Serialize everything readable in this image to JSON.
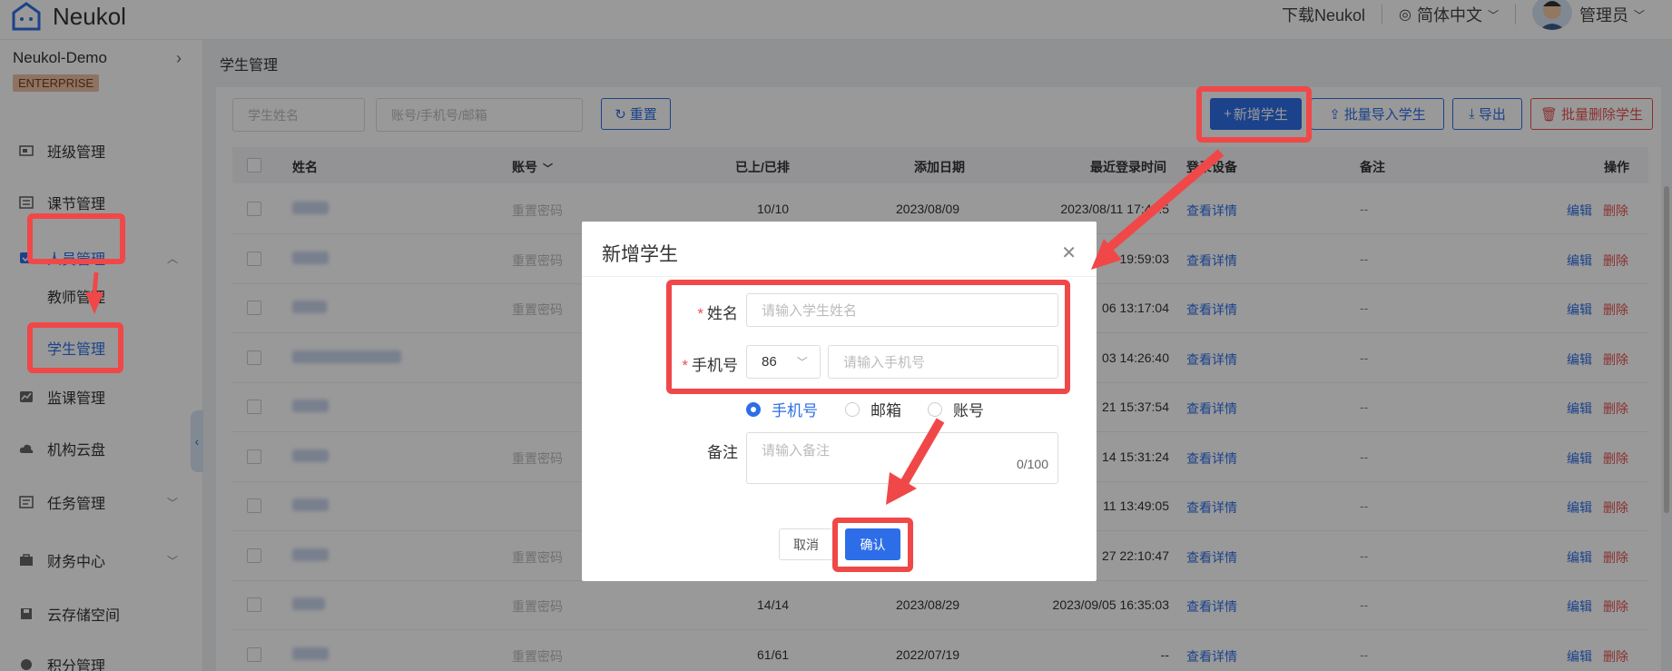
{
  "app": {
    "name": "Neukol"
  },
  "topbar": {
    "download": "下载Neukol",
    "language": "简体中文",
    "user": "管理员"
  },
  "sidebar": {
    "org": "Neukol-Demo",
    "badge": "ENTERPRISE",
    "items": [
      {
        "label": "班级管理",
        "icon": "class-icon"
      },
      {
        "label": "课节管理",
        "icon": "list-icon"
      },
      {
        "label": "人员管理",
        "icon": "people-icon"
      },
      {
        "label": "监课管理",
        "icon": "monitor-icon"
      },
      {
        "label": "机构云盘",
        "icon": "cloud-icon"
      },
      {
        "label": "任务管理",
        "icon": "task-icon"
      },
      {
        "label": "财务中心",
        "icon": "finance-icon"
      },
      {
        "label": "云存储空间",
        "icon": "storage-icon"
      },
      {
        "label": "积分管理",
        "icon": "points-icon"
      }
    ],
    "subitems": [
      "教师管理",
      "学生管理"
    ]
  },
  "main": {
    "breadcrumb": "学生管理",
    "filters": {
      "name_placeholder": "学生姓名",
      "account_placeholder": "账号/手机号/邮箱",
      "reset": "重置"
    },
    "actions": {
      "add": "新增学生",
      "import": "批量导入学生",
      "export": "导出",
      "batch_delete": "批量删除学生"
    },
    "columns": [
      "姓名",
      "账号",
      "已上/已排",
      "添加日期",
      "最近登录时间",
      "登录设备",
      "备注",
      "操作"
    ],
    "rows": [
      {
        "account": "重置密码",
        "sessions": "10/10",
        "date": "2023/08/09",
        "last": "2023/08/11 17:43:5",
        "device": "查看详情",
        "note": "--"
      },
      {
        "account": "重置密码",
        "sessions": "",
        "date": "",
        "last": "19:59:03",
        "device": "查看详情",
        "note": "--"
      },
      {
        "account": "重置密码",
        "sessions": "",
        "date": "",
        "last": "06 13:17:04",
        "device": "查看详情",
        "note": "--"
      },
      {
        "account": "",
        "sessions": "",
        "date": "",
        "last": "03 14:26:40",
        "device": "查看详情",
        "note": "--"
      },
      {
        "account": "",
        "sessions": "",
        "date": "",
        "last": "21 15:37:54",
        "device": "查看详情",
        "note": "--"
      },
      {
        "account": "重置密码",
        "sessions": "",
        "date": "",
        "last": "14 15:31:24",
        "device": "查看详情",
        "note": "--"
      },
      {
        "account": "",
        "sessions": "",
        "date": "",
        "last": "11 13:49:05",
        "device": "查看详情",
        "note": "--"
      },
      {
        "account": "重置密码",
        "sessions": "",
        "date": "",
        "last": "27 22:10:47",
        "device": "查看详情",
        "note": "--"
      },
      {
        "account": "重置密码",
        "sessions": "14/14",
        "date": "2023/08/29",
        "last": "2023/09/05 16:35:03",
        "device": "查看详情",
        "note": "--"
      },
      {
        "account": "重置密码",
        "sessions": "61/61",
        "date": "2022/07/19",
        "last": "--",
        "device": "查看详情",
        "note": "--"
      }
    ],
    "row_actions": {
      "edit": "编辑",
      "delete": "删除"
    }
  },
  "modal": {
    "title": "新增学生",
    "name_label": "姓名",
    "name_placeholder": "请输入学生姓名",
    "phone_label": "手机号",
    "country_code": "86",
    "phone_placeholder": "请输入手机号",
    "radio_options": [
      "手机号",
      "邮箱",
      "账号"
    ],
    "note_label": "备注",
    "note_placeholder": "请输入备注",
    "note_counter": "0/100",
    "cancel": "取消",
    "confirm": "确认"
  },
  "colors": {
    "primary": "#2d6ee8",
    "danger": "#e85050",
    "highlight": "#f04848"
  }
}
